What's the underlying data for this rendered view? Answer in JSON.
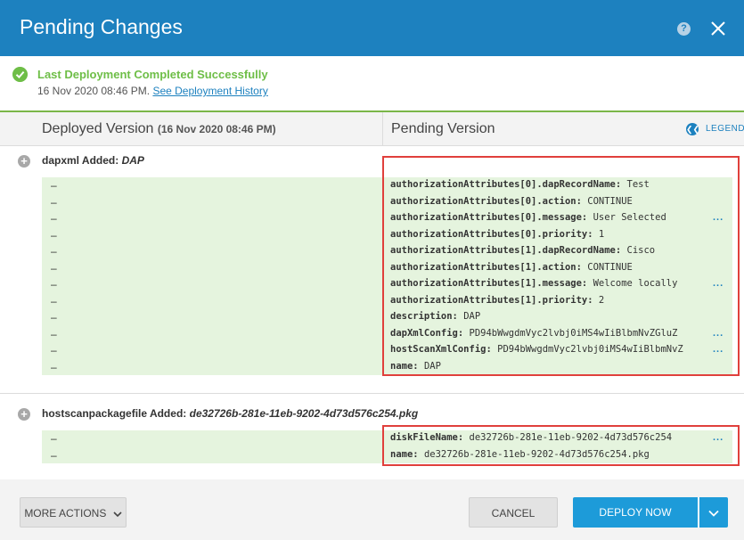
{
  "header": {
    "title": "Pending Changes",
    "help_glyph": "?"
  },
  "status": {
    "title": "Last Deployment Completed Successfully",
    "date": "16 Nov 2020 08:46 PM.",
    "history_link": "See Deployment History",
    "color": "#6ebe47"
  },
  "columns": {
    "left_title": "Deployed Version",
    "left_date": "(16 Nov 2020 08:46 PM)",
    "right_title": "Pending Version",
    "legend_label": "LEGEND"
  },
  "sections": [
    {
      "label": "dapxml Added:",
      "name": "DAP",
      "rows": [
        {
          "deployed": "–",
          "key": "authorizationAttributes[0].dapRecordName:",
          "value": "Test",
          "more": ""
        },
        {
          "deployed": "–",
          "key": "authorizationAttributes[0].action:",
          "value": "CONTINUE",
          "more": ""
        },
        {
          "deployed": "–",
          "key": "authorizationAttributes[0].message:",
          "value": "User Selected",
          "more": "..."
        },
        {
          "deployed": "–",
          "key": "authorizationAttributes[0].priority:",
          "value": "1",
          "more": ""
        },
        {
          "deployed": "–",
          "key": "authorizationAttributes[1].dapRecordName:",
          "value": "Cisco",
          "more": ""
        },
        {
          "deployed": "–",
          "key": "authorizationAttributes[1].action:",
          "value": "CONTINUE",
          "more": ""
        },
        {
          "deployed": "–",
          "key": "authorizationAttributes[1].message:",
          "value": "Welcome locally",
          "more": "..."
        },
        {
          "deployed": "–",
          "key": "authorizationAttributes[1].priority:",
          "value": "2",
          "more": ""
        },
        {
          "deployed": "–",
          "key": "description:",
          "value": "DAP",
          "more": ""
        },
        {
          "deployed": "–",
          "key": "dapXmlConfig:",
          "value": "PD94bWwgdmVyc2lvbj0iMS4wIiBlbmNvZGluZ",
          "more": "..."
        },
        {
          "deployed": "–",
          "key": "hostScanXmlConfig:",
          "value": "PD94bWwgdmVyc2lvbj0iMS4wIiBlbmNvZ",
          "more": "..."
        },
        {
          "deployed": "–",
          "key": "name:",
          "value": "DAP",
          "more": ""
        }
      ]
    },
    {
      "label": "hostscanpackagefile Added:",
      "name": "de32726b-281e-11eb-9202-4d73d576c254.pkg",
      "rows": [
        {
          "deployed": "–",
          "key": "diskFileName:",
          "value": "de32726b-281e-11eb-9202-4d73d576c254",
          "more": "..."
        },
        {
          "deployed": "–",
          "key": "name:",
          "value": "de32726b-281e-11eb-9202-4d73d576c254.pkg",
          "more": ""
        }
      ]
    }
  ],
  "footer": {
    "more_actions": "MORE ACTIONS",
    "cancel": "CANCEL",
    "deploy_now": "DEPLOY NOW"
  },
  "colors": {
    "header": "#1d81bf",
    "added_row": "#e5f4de",
    "highlight_box": "#e0403c",
    "deploy_button": "#1d9bd9"
  },
  "icons": [
    "help-icon",
    "close-icon",
    "check-circle-icon",
    "legend-icon",
    "plus-circle-icon",
    "chevron-down-icon"
  ]
}
